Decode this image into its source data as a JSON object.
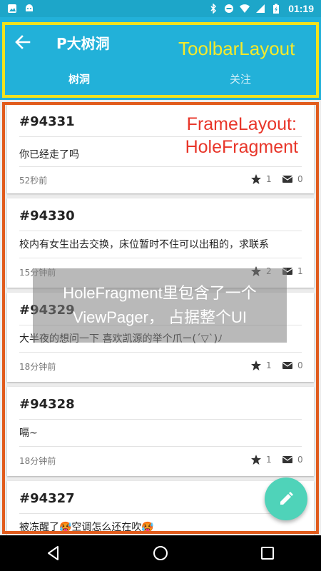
{
  "statusbar": {
    "time": "01:19"
  },
  "toolbar": {
    "title": "P大树洞",
    "annotation": "ToolbarLayout",
    "tabs": [
      {
        "label": "树洞",
        "active": true
      },
      {
        "label": "关注",
        "active": false
      }
    ]
  },
  "annotations": {
    "frame_line1": "FrameLayout:",
    "frame_line2": "HoleFragment",
    "overlay_line1": "HoleFragment里包含了一个",
    "overlay_line2": "ViewPager， 占据整个UI"
  },
  "posts": [
    {
      "id": "#94331",
      "text": "你已经走了吗",
      "time": "52秒前",
      "stars": "1",
      "replies": "0"
    },
    {
      "id": "#94330",
      "text": "校内有女生出去交换，床位暂时不住可以出租的，求联系",
      "time": "15分钟前",
      "stars": "2",
      "replies": "1"
    },
    {
      "id": "#94329",
      "text": "大半夜的想问一下 喜欢凯源的举个爪ー(´▽`)ﾉ",
      "time": "18分钟前",
      "stars": "1",
      "replies": "0"
    },
    {
      "id": "#94328",
      "text": "嗝~",
      "time": "18分钟前",
      "stars": "1",
      "replies": "0"
    },
    {
      "id": "#94327",
      "text": "被冻醒了🥵空调怎么还在吹🥵",
      "time": "",
      "stars": "",
      "replies": ""
    }
  ],
  "colors": {
    "toolbar": "#22b1d9",
    "statusbar": "#1da6c9",
    "toolbar_outline": "#f0e21d",
    "frame_outline": "#e15b1c",
    "fab": "#4fd3b9"
  },
  "icons": {
    "back": "arrow-left-icon",
    "fab": "pencil-icon",
    "star": "star-icon",
    "reply": "mail-icon"
  }
}
